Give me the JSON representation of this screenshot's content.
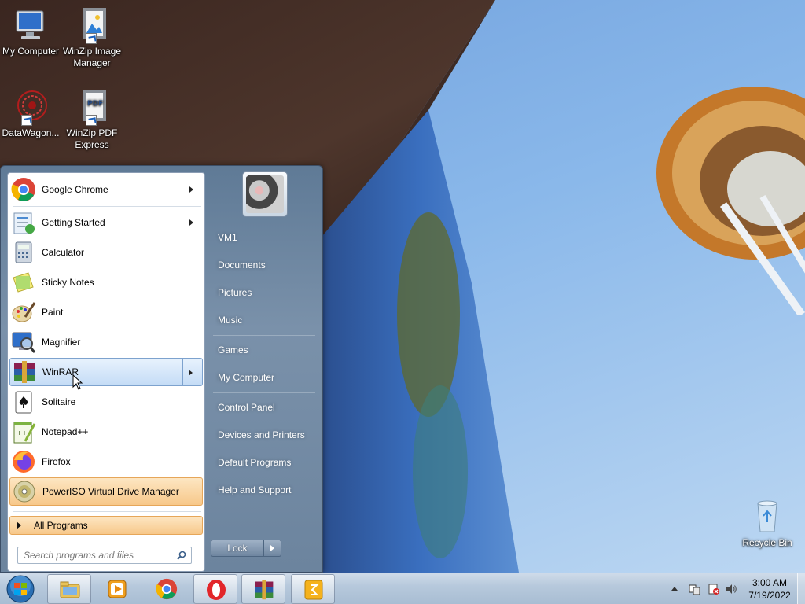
{
  "desktop": {
    "icons": [
      {
        "label": "My Computer",
        "icon": "computer-icon"
      },
      {
        "label": "WinZip Image Manager",
        "icon": "winzip-image-icon"
      },
      {
        "label": "DataWagon...",
        "icon": "datawagon-icon"
      },
      {
        "label": "WinZip PDF Express",
        "icon": "winzip-pdf-icon"
      }
    ],
    "recycle_bin": {
      "label": "Recycle Bin",
      "icon": "recycle-bin-icon"
    }
  },
  "start_menu": {
    "programs": [
      {
        "label": "Google Chrome",
        "icon": "chrome-icon",
        "has_submenu": true,
        "state": "normal"
      },
      {
        "label": "Getting Started",
        "icon": "getting-started-icon",
        "has_submenu": true,
        "state": "normal"
      },
      {
        "label": "Calculator",
        "icon": "calculator-icon",
        "has_submenu": false,
        "state": "normal"
      },
      {
        "label": "Sticky Notes",
        "icon": "sticky-notes-icon",
        "has_submenu": false,
        "state": "normal"
      },
      {
        "label": "Paint",
        "icon": "paint-icon",
        "has_submenu": false,
        "state": "normal"
      },
      {
        "label": "Magnifier",
        "icon": "magnifier-icon",
        "has_submenu": false,
        "state": "normal"
      },
      {
        "label": "WinRAR",
        "icon": "winrar-icon",
        "has_submenu": true,
        "state": "hover"
      },
      {
        "label": "Solitaire",
        "icon": "solitaire-icon",
        "has_submenu": false,
        "state": "normal"
      },
      {
        "label": "Notepad++",
        "icon": "notepadpp-icon",
        "has_submenu": false,
        "state": "normal"
      },
      {
        "label": "Firefox",
        "icon": "firefox-icon",
        "has_submenu": false,
        "state": "normal"
      },
      {
        "label": "PowerISO Virtual Drive Manager",
        "icon": "poweriso-icon",
        "has_submenu": false,
        "state": "highlighted"
      }
    ],
    "all_programs": "All Programs",
    "search_placeholder": "Search programs and files",
    "user_name": "VM1",
    "places": [
      {
        "label": "VM1",
        "group": 1
      },
      {
        "label": "Documents",
        "group": 1
      },
      {
        "label": "Pictures",
        "group": 1
      },
      {
        "label": "Music",
        "group": 1
      },
      {
        "label": "Games",
        "group": 2
      },
      {
        "label": "My Computer",
        "group": 2
      },
      {
        "label": "Control Panel",
        "group": 3
      },
      {
        "label": "Devices and Printers",
        "group": 3
      },
      {
        "label": "Default Programs",
        "group": 3
      },
      {
        "label": "Help and Support",
        "group": 3
      }
    ],
    "lock_label": "Lock"
  },
  "taskbar": {
    "pinned": [
      {
        "name": "explorer",
        "icon": "folder-icon",
        "active": true
      },
      {
        "name": "media-player",
        "icon": "media-player-icon",
        "active": false
      },
      {
        "name": "chrome",
        "icon": "chrome-icon",
        "active": false
      },
      {
        "name": "opera",
        "icon": "opera-icon",
        "active": true
      },
      {
        "name": "winrar",
        "icon": "winrar-icon",
        "active": true
      },
      {
        "name": "app",
        "icon": "note-app-icon",
        "active": true
      }
    ],
    "clock": {
      "time": "3:00 AM",
      "date": "7/19/2022"
    }
  },
  "colors": {
    "menu_hover": "#c4dcf6",
    "menu_highlight": "#f7c88a",
    "taskbar": "#b7c9dc"
  }
}
